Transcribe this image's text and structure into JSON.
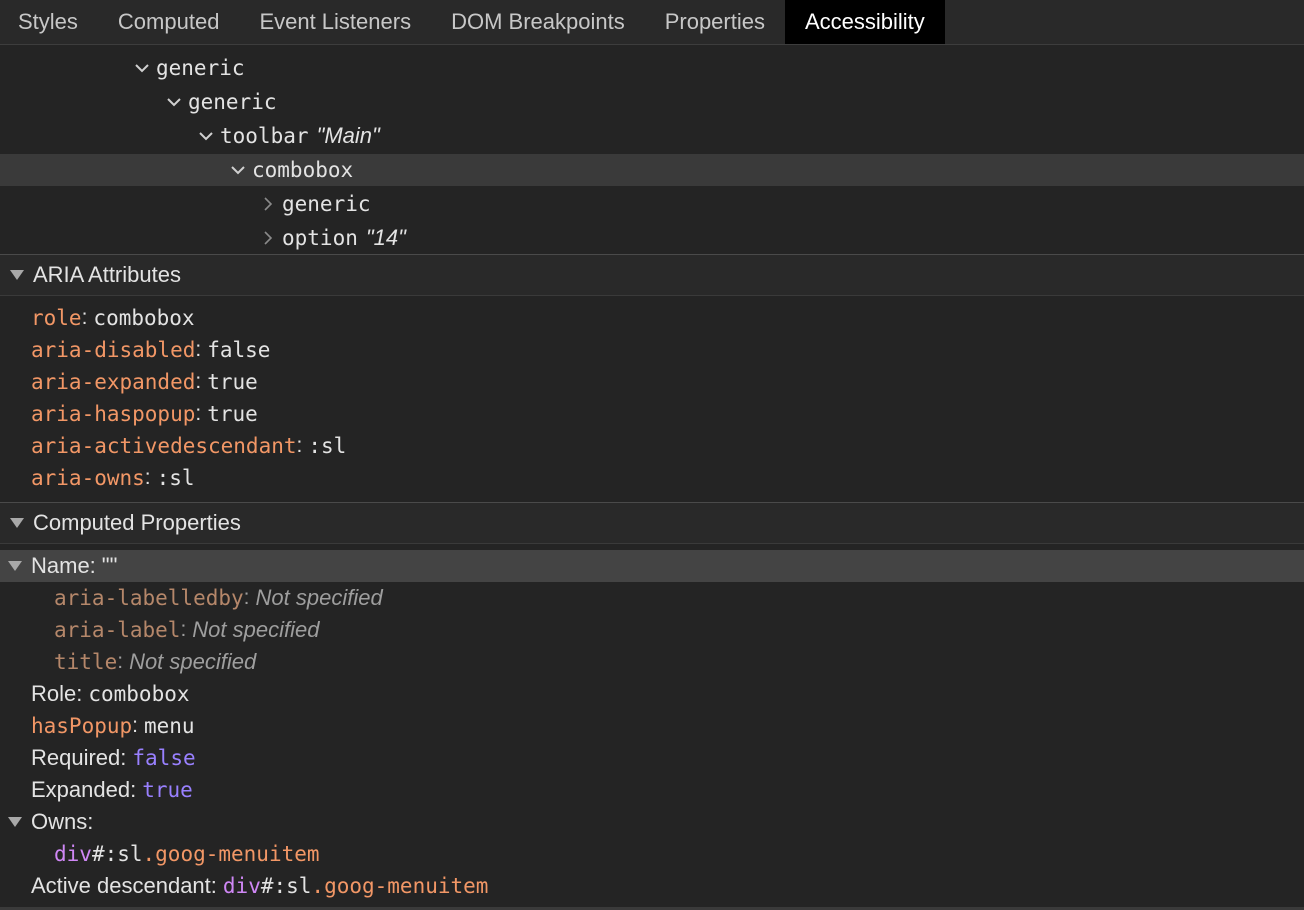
{
  "tabs": [
    "Styles",
    "Computed",
    "Event Listeners",
    "DOM Breakpoints",
    "Properties",
    "Accessibility"
  ],
  "active_tab": "Accessibility",
  "tree": [
    {
      "role": "generic",
      "name": "",
      "expanded": true
    },
    {
      "role": "generic",
      "name": "",
      "expanded": true
    },
    {
      "role": "toolbar",
      "name": "\"Main\"",
      "expanded": true
    },
    {
      "role": "combobox",
      "name": "",
      "expanded": true,
      "selected": true
    },
    {
      "role": "generic",
      "name": "",
      "expanded": false
    },
    {
      "role": "option",
      "name": "\"14\"",
      "expanded": false
    }
  ],
  "aria_section": {
    "title": "ARIA Attributes",
    "attributes": [
      {
        "key": "role",
        "value": "combobox"
      },
      {
        "key": "aria-disabled",
        "value": "false"
      },
      {
        "key": "aria-expanded",
        "value": "true"
      },
      {
        "key": "aria-haspopup",
        "value": "true"
      },
      {
        "key": "aria-activedescendant",
        "value": ":sl"
      },
      {
        "key": "aria-owns",
        "value": ":sl"
      }
    ]
  },
  "computed_section": {
    "title": "Computed Properties",
    "name_label": "Name:",
    "name_value": "\"\"",
    "name_sources": [
      {
        "key": "aria-labelledby",
        "value": "Not specified"
      },
      {
        "key": "aria-label",
        "value": "Not specified"
      },
      {
        "key": "title",
        "value": "Not specified"
      }
    ],
    "role_label": "Role:",
    "role_value": "combobox",
    "haspopup_key": "hasPopup",
    "haspopup_value": "menu",
    "required_label": "Required:",
    "required_value": "false",
    "expanded_label": "Expanded:",
    "expanded_value": "true",
    "owns_label": "Owns:",
    "owns_node": {
      "tag": "div",
      "id": "#:sl",
      "cls": ".goog-menuitem"
    },
    "active_desc_label": "Active descendant:",
    "active_desc_node": {
      "tag": "div",
      "id": "#:sl",
      "cls": ".goog-menuitem"
    }
  },
  "colors": {
    "background": "#242424",
    "attr_key": "#f29766",
    "boolean": "#9980ff",
    "tag": "#cf87f5",
    "active_tab_bg": "#000000"
  }
}
